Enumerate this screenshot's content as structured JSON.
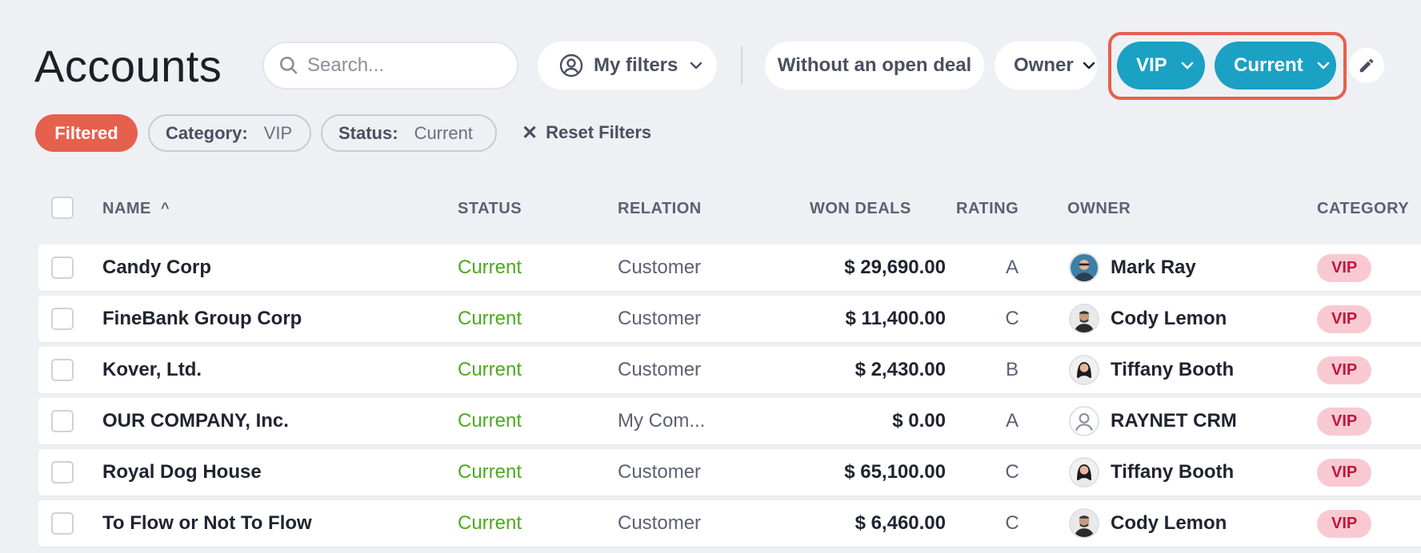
{
  "page": {
    "title": "Accounts"
  },
  "search": {
    "placeholder": "Search..."
  },
  "filters_bar": {
    "my_filters_label": "My filters",
    "without_open_deal_label": "Without an open deal",
    "owner_label": "Owner",
    "vip_label": "VIP",
    "current_label": "Current"
  },
  "active_filters": {
    "filtered_label": "Filtered",
    "chips": [
      {
        "key": "Category:",
        "value": "VIP"
      },
      {
        "key": "Status:",
        "value": "Current"
      }
    ],
    "reset_label": "Reset Filters"
  },
  "table": {
    "columns": [
      "NAME",
      "STATUS",
      "RELATION",
      "WON DEALS",
      "RATING",
      "OWNER",
      "CATEGORY"
    ],
    "sort_indicator": "^",
    "rows": [
      {
        "name": "Candy Corp",
        "status": "Current",
        "relation": "Customer",
        "won_deals": "$ 29,690.00",
        "rating": "A",
        "owner": "Mark Ray",
        "category": "VIP"
      },
      {
        "name": "FineBank Group Corp",
        "status": "Current",
        "relation": "Customer",
        "won_deals": "$ 11,400.00",
        "rating": "C",
        "owner": "Cody Lemon",
        "category": "VIP"
      },
      {
        "name": "Kover, Ltd.",
        "status": "Current",
        "relation": "Customer",
        "won_deals": "$ 2,430.00",
        "rating": "B",
        "owner": "Tiffany Booth",
        "category": "VIP"
      },
      {
        "name": "OUR COMPANY, Inc.",
        "status": "Current",
        "relation": "My Com...",
        "won_deals": "$ 0.00",
        "rating": "A",
        "owner": "RAYNET CRM",
        "category": "VIP"
      },
      {
        "name": "Royal Dog House",
        "status": "Current",
        "relation": "Customer",
        "won_deals": "$ 65,100.00",
        "rating": "C",
        "owner": "Tiffany Booth",
        "category": "VIP"
      },
      {
        "name": "To Flow or Not To Flow",
        "status": "Current",
        "relation": "Customer",
        "won_deals": "$ 6,460.00",
        "rating": "C",
        "owner": "Cody Lemon",
        "category": "VIP"
      }
    ]
  },
  "colors": {
    "accent_blue": "#1ba1c4",
    "filtered_red": "#e6604e",
    "status_green": "#4caa1c",
    "vip_badge_bg": "#f9c9d2",
    "vip_badge_text": "#c0163c"
  }
}
